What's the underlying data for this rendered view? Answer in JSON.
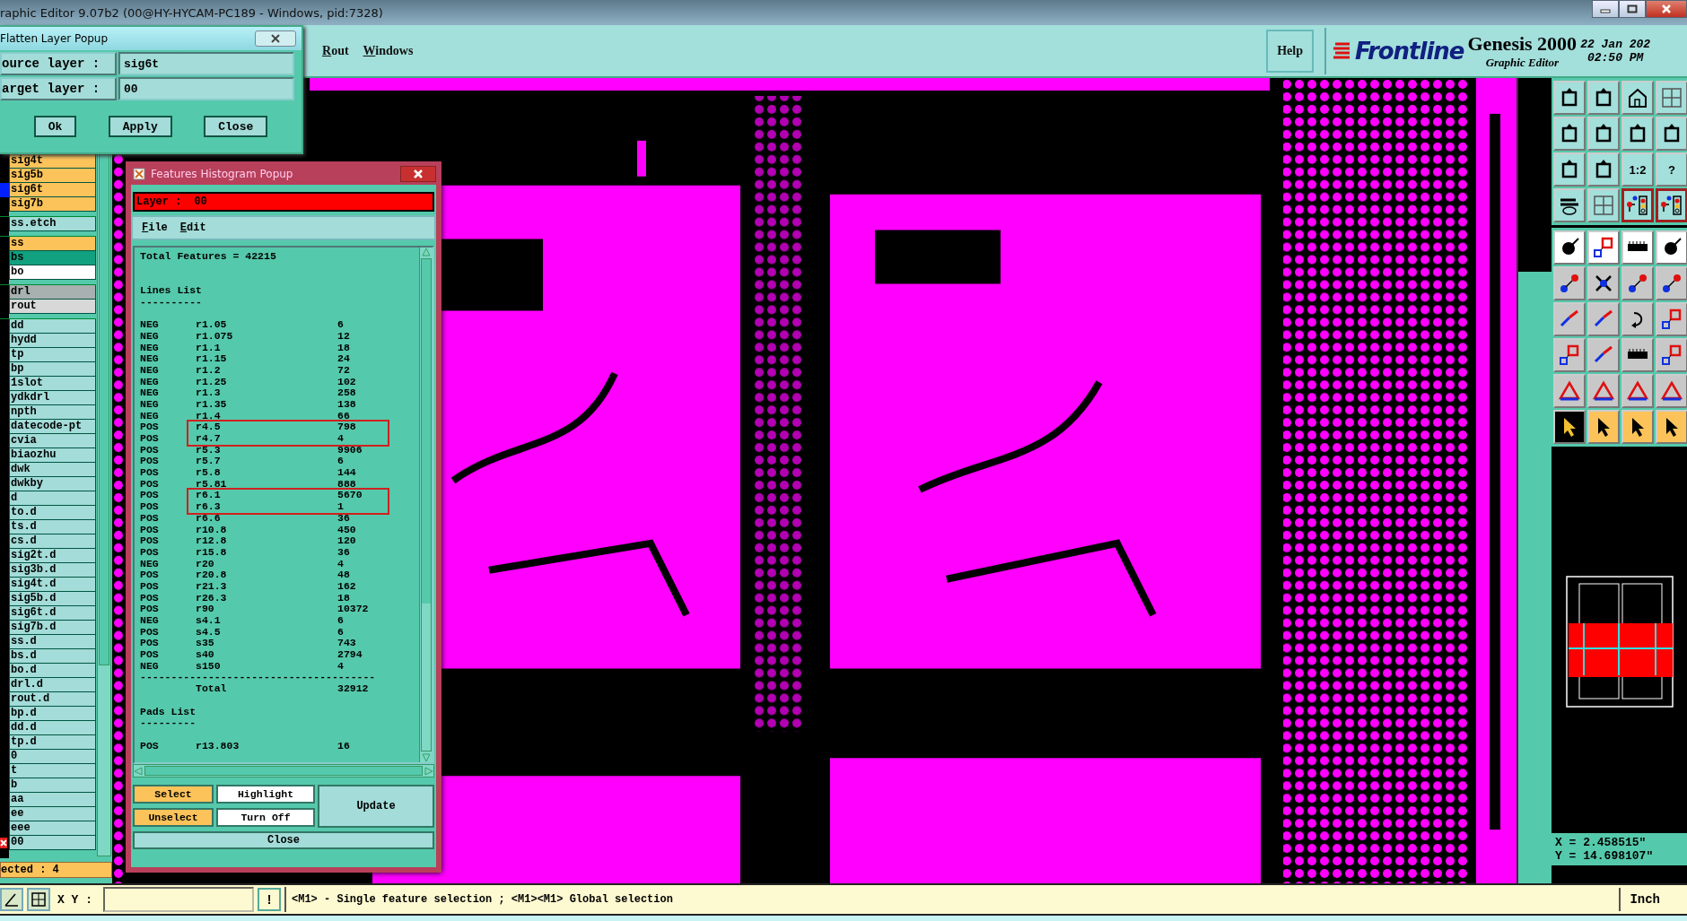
{
  "window": {
    "title": "raphic Editor 9.07b2 (00@HY-HYCAM-PC189 - Windows, pid:7328)"
  },
  "menu": {
    "items": [
      "Rout",
      "Windows"
    ],
    "help": "Help"
  },
  "brand": {
    "logo": "Frontline",
    "product": "Genesis 2000",
    "subtitle": "Graphic Editor",
    "date": "22 Jan 202",
    "time": "02:50 PM"
  },
  "layer_groups": [
    {
      "items": [
        {
          "label": "sig4t",
          "color": "#fbc35a",
          "kind": "layer"
        },
        {
          "label": "sig5b",
          "color": "#fbc35a",
          "kind": "layer"
        },
        {
          "label": "sig6t",
          "color": "#fbc35a",
          "kind": "marked"
        },
        {
          "label": "sig7b",
          "color": "#fbc35a",
          "kind": "layer"
        }
      ]
    },
    {
      "items": [
        {
          "label": "ss.etch",
          "color": "#a3dcd8",
          "kind": "layer"
        }
      ]
    },
    {
      "items": [
        {
          "label": "ss",
          "color": "#fbc35a",
          "kind": "layer"
        },
        {
          "label": "bs",
          "color": "#11a080",
          "kind": "layer"
        },
        {
          "label": "bo",
          "color": "#ffffff",
          "kind": "layer"
        }
      ]
    },
    {
      "items": [
        {
          "label": "drl",
          "color": "#a8b0b0",
          "kind": "layer"
        },
        {
          "label": "rout",
          "color": "#d8d8d8",
          "kind": "layer"
        }
      ]
    },
    {
      "items": [
        {
          "label": "dd",
          "color": "#a3dcd8",
          "kind": "layer"
        },
        {
          "label": "hydd",
          "color": "#a3dcd8",
          "kind": "layer"
        },
        {
          "label": "tp",
          "color": "#a3dcd8",
          "kind": "layer"
        },
        {
          "label": "bp",
          "color": "#a3dcd8",
          "kind": "layer"
        },
        {
          "label": "1slot",
          "color": "#a3dcd8",
          "kind": "layer"
        },
        {
          "label": "ydkdrl",
          "color": "#a3dcd8",
          "kind": "layer"
        },
        {
          "label": "npth",
          "color": "#a3dcd8",
          "kind": "layer"
        },
        {
          "label": "datecode-pt",
          "color": "#a3dcd8",
          "kind": "layer"
        },
        {
          "label": "cvia",
          "color": "#a3dcd8",
          "kind": "layer"
        },
        {
          "label": "biaozhu",
          "color": "#a3dcd8",
          "kind": "layer"
        },
        {
          "label": "dwk",
          "color": "#a3dcd8",
          "kind": "layer"
        },
        {
          "label": "dwkby",
          "color": "#a3dcd8",
          "kind": "layer"
        },
        {
          "label": "d",
          "color": "#a3dcd8",
          "kind": "layer"
        },
        {
          "label": "to.d",
          "color": "#a3dcd8",
          "kind": "layer"
        },
        {
          "label": "ts.d",
          "color": "#a3dcd8",
          "kind": "layer"
        },
        {
          "label": "cs.d",
          "color": "#a3dcd8",
          "kind": "layer"
        },
        {
          "label": "sig2t.d",
          "color": "#a3dcd8",
          "kind": "layer"
        },
        {
          "label": "sig3b.d",
          "color": "#a3dcd8",
          "kind": "layer"
        },
        {
          "label": "sig4t.d",
          "color": "#a3dcd8",
          "kind": "layer"
        },
        {
          "label": "sig5b.d",
          "color": "#a3dcd8",
          "kind": "layer"
        },
        {
          "label": "sig6t.d",
          "color": "#a3dcd8",
          "kind": "layer"
        },
        {
          "label": "sig7b.d",
          "color": "#a3dcd8",
          "kind": "layer"
        },
        {
          "label": "ss.d",
          "color": "#a3dcd8",
          "kind": "layer"
        },
        {
          "label": "bs.d",
          "color": "#a3dcd8",
          "kind": "layer"
        },
        {
          "label": "bo.d",
          "color": "#a3dcd8",
          "kind": "layer"
        },
        {
          "label": "drl.d",
          "color": "#a3dcd8",
          "kind": "layer"
        },
        {
          "label": "rout.d",
          "color": "#a3dcd8",
          "kind": "layer"
        },
        {
          "label": "bp.d",
          "color": "#a3dcd8",
          "kind": "layer"
        },
        {
          "label": "dd.d",
          "color": "#a3dcd8",
          "kind": "layer"
        },
        {
          "label": "tp.d",
          "color": "#a3dcd8",
          "kind": "layer"
        },
        {
          "label": "0",
          "color": "#a3dcd8",
          "kind": "layer"
        },
        {
          "label": "t",
          "color": "#a3dcd8",
          "kind": "layer"
        },
        {
          "label": "b",
          "color": "#a3dcd8",
          "kind": "layer"
        },
        {
          "label": "aa",
          "color": "#a3dcd8",
          "kind": "layer"
        },
        {
          "label": "ee",
          "color": "#a3dcd8",
          "kind": "layer"
        },
        {
          "label": "eee",
          "color": "#a3dcd8",
          "kind": "layer"
        },
        {
          "label": "00",
          "color": "#a3dcd8",
          "kind": "work"
        }
      ]
    }
  ],
  "affected": "ected : 4",
  "flatten_popup": {
    "title": "Flatten Layer Popup",
    "fields": [
      {
        "label": "ource layer :",
        "value": "sig6t"
      },
      {
        "label": "arget layer :",
        "value": "00"
      }
    ],
    "buttons": [
      "Ok",
      "Apply",
      "Close"
    ]
  },
  "histogram_popup": {
    "title": "Features Histogram Popup",
    "layer_label": "Layer :",
    "layer": "00",
    "menu": [
      "File",
      "Edit"
    ],
    "summary": "Total Features = 42215",
    "sections": [
      {
        "title": "Lines List",
        "underline": "----------",
        "rows": [
          {
            "polarity": "NEG",
            "symbol": "r1.05",
            "count": "6",
            "highlighted": false
          },
          {
            "polarity": "NEG",
            "symbol": "r1.075",
            "count": "12",
            "highlighted": false
          },
          {
            "polarity": "NEG",
            "symbol": "r1.1",
            "count": "18",
            "highlighted": false
          },
          {
            "polarity": "NEG",
            "symbol": "r1.15",
            "count": "24",
            "highlighted": false
          },
          {
            "polarity": "NEG",
            "symbol": "r1.2",
            "count": "72",
            "highlighted": false
          },
          {
            "polarity": "NEG",
            "symbol": "r1.25",
            "count": "102",
            "highlighted": false
          },
          {
            "polarity": "NEG",
            "symbol": "r1.3",
            "count": "258",
            "highlighted": false
          },
          {
            "polarity": "NEG",
            "symbol": "r1.35",
            "count": "138",
            "highlighted": false
          },
          {
            "polarity": "NEG",
            "symbol": "r1.4",
            "count": "66",
            "highlighted": false
          },
          {
            "polarity": "POS",
            "symbol": "r4.5",
            "count": "798",
            "highlighted": true
          },
          {
            "polarity": "POS",
            "symbol": "r4.7",
            "count": "4",
            "highlighted": true
          },
          {
            "polarity": "POS",
            "symbol": "r5.3",
            "count": "9906",
            "highlighted": false
          },
          {
            "polarity": "POS",
            "symbol": "r5.7",
            "count": "6",
            "highlighted": false
          },
          {
            "polarity": "POS",
            "symbol": "r5.8",
            "count": "144",
            "highlighted": false
          },
          {
            "polarity": "POS",
            "symbol": "r5.81",
            "count": "888",
            "highlighted": false
          },
          {
            "polarity": "POS",
            "symbol": "r6.1",
            "count": "5670",
            "highlighted": true
          },
          {
            "polarity": "POS",
            "symbol": "r6.3",
            "count": "1",
            "highlighted": true
          },
          {
            "polarity": "POS",
            "symbol": "r6.6",
            "count": "36",
            "highlighted": false
          },
          {
            "polarity": "POS",
            "symbol": "r10.8",
            "count": "450",
            "highlighted": false
          },
          {
            "polarity": "POS",
            "symbol": "r12.8",
            "count": "120",
            "highlighted": false
          },
          {
            "polarity": "POS",
            "symbol": "r15.8",
            "count": "36",
            "highlighted": false
          },
          {
            "polarity": "NEG",
            "symbol": "r20",
            "count": "4",
            "highlighted": false
          },
          {
            "polarity": "POS",
            "symbol": "r20.8",
            "count": "48",
            "highlighted": false
          },
          {
            "polarity": "POS",
            "symbol": "r21.3",
            "count": "162",
            "highlighted": false
          },
          {
            "polarity": "POS",
            "symbol": "r26.3",
            "count": "18",
            "highlighted": false
          },
          {
            "polarity": "POS",
            "symbol": "r90",
            "count": "10372",
            "highlighted": false
          },
          {
            "polarity": "NEG",
            "symbol": "s4.1",
            "count": "6",
            "highlighted": false
          },
          {
            "polarity": "POS",
            "symbol": "s4.5",
            "count": "6",
            "highlighted": false
          },
          {
            "polarity": "POS",
            "symbol": "s35",
            "count": "743",
            "highlighted": false
          },
          {
            "polarity": "POS",
            "symbol": "s40",
            "count": "2794",
            "highlighted": false
          },
          {
            "polarity": "NEG",
            "symbol": "s150",
            "count": "4",
            "highlighted": false
          }
        ],
        "rule": "--------------------------------------",
        "total": {
          "label": "Total",
          "count": "32912"
        }
      },
      {
        "title": "Pads List",
        "underline": "---------",
        "rows": [
          {
            "polarity": "POS",
            "symbol": "r13.803",
            "count": "16",
            "highlighted": false
          }
        ]
      }
    ],
    "buttons": [
      {
        "label": "Select",
        "color": "#fbc35a"
      },
      {
        "label": "Highlight",
        "color": "#ffffff"
      },
      {
        "label": "Unselect",
        "color": "#fbc35a"
      },
      {
        "label": "Turn Off",
        "color": "#ffffff"
      }
    ],
    "update": "Update",
    "close": "Close"
  },
  "tools": [
    {
      "kind": "view",
      "selected": false
    },
    {
      "kind": "view",
      "selected": false
    },
    {
      "kind": "view",
      "selected": false
    },
    {
      "kind": "view",
      "selected": false
    },
    {
      "kind": "view",
      "selected": false
    },
    {
      "kind": "view",
      "selected": false
    },
    {
      "kind": "view",
      "selected": false
    },
    {
      "kind": "view",
      "selected": false
    },
    {
      "kind": "view",
      "selected": false
    },
    {
      "kind": "view",
      "selected": false
    },
    {
      "kind": "view",
      "selected": false,
      "label": "1:2"
    },
    {
      "kind": "view",
      "selected": false,
      "label": "?"
    },
    {
      "kind": "view",
      "selected": false
    },
    {
      "kind": "view",
      "selected": false
    },
    {
      "kind": "view",
      "selected": true
    },
    {
      "kind": "view",
      "selected": true
    },
    {
      "kind": "measure",
      "selected": false
    },
    {
      "kind": "measure",
      "selected": false
    },
    {
      "kind": "measure",
      "selected": false
    },
    {
      "kind": "measure",
      "selected": false
    },
    {
      "kind": "edit",
      "selected": false
    },
    {
      "kind": "edit",
      "selected": false
    },
    {
      "kind": "edit",
      "selected": false
    },
    {
      "kind": "edit",
      "selected": false
    },
    {
      "kind": "edit",
      "selected": false
    },
    {
      "kind": "edit",
      "selected": false
    },
    {
      "kind": "edit",
      "selected": false
    },
    {
      "kind": "edit",
      "selected": false
    },
    {
      "kind": "edit",
      "selected": false
    },
    {
      "kind": "edit",
      "selected": false
    },
    {
      "kind": "edit",
      "selected": false
    },
    {
      "kind": "edit",
      "selected": false
    },
    {
      "kind": "edit",
      "selected": false
    },
    {
      "kind": "edit",
      "selected": false
    },
    {
      "kind": "edit",
      "selected": false
    },
    {
      "kind": "edit",
      "selected": false
    },
    {
      "kind": "select",
      "selected": true
    },
    {
      "kind": "select",
      "selected": false
    },
    {
      "kind": "select",
      "selected": false
    },
    {
      "kind": "select",
      "selected": false
    }
  ],
  "coordinates": [
    "X = 2.458515\"",
    "Y = 14.698107\""
  ],
  "status_bar": {
    "xy_label": "X Y :",
    "bang": "!",
    "message": "<M1> - Single feature selection ; <M1><M1> Global selection",
    "units": "Inch"
  }
}
